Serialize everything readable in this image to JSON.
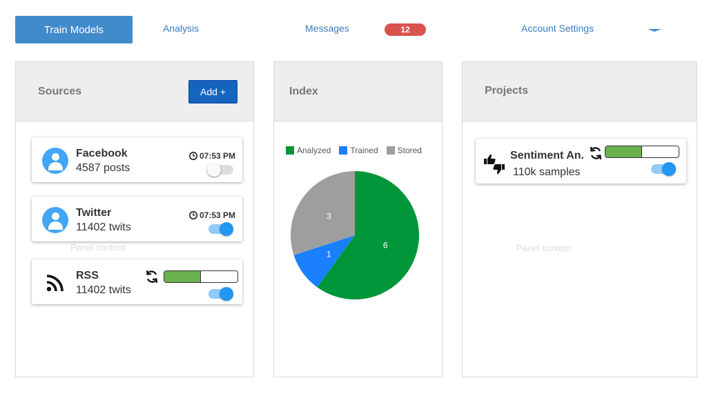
{
  "nav": {
    "train_models": "Train Models",
    "analysis": "Analysis",
    "messages": "Messages",
    "messages_count": "12",
    "account_settings": "Account Settings"
  },
  "sources": {
    "title": "Sources",
    "add_label": "Add +",
    "ghost_text": "Panel content",
    "items": [
      {
        "name": "Facebook",
        "detail": "4587 posts",
        "time": "07:53 PM",
        "enabled": false
      },
      {
        "name": "Twitter",
        "detail": "11402 twits",
        "time": "07:53 PM",
        "enabled": true
      },
      {
        "name": "RSS",
        "detail": "11402 twits",
        "progress": 0.5,
        "enabled": true
      }
    ]
  },
  "index": {
    "title": "Index"
  },
  "projects": {
    "title": "Projects",
    "ghost_text": "Panel content",
    "items": [
      {
        "name": "Sentiment An.",
        "detail": "110k samples",
        "progress": 0.5,
        "enabled": true
      }
    ]
  },
  "chart_data": {
    "type": "pie",
    "categories": [
      "Analyzed",
      "Trained",
      "Stored"
    ],
    "values": [
      6,
      1,
      3
    ],
    "colors": [
      "#009639",
      "#1a80ff",
      "#9e9e9e"
    ],
    "legend": "top"
  },
  "icons": {
    "clock": "clock-icon",
    "sync": "sync-icon",
    "rss": "rss-icon",
    "thumbs": "thumbs-up-down-icon",
    "avatar": "user-avatar-icon"
  }
}
